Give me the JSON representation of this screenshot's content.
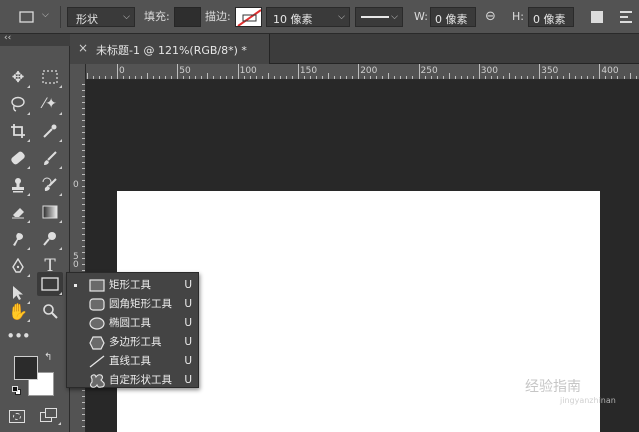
{
  "options_bar": {
    "mode_value": "形状",
    "fill_label": "填充:",
    "stroke_label": "描边:",
    "stroke_width_value": "10 像素",
    "w_label": "W:",
    "w_value": "0 像素",
    "h_label": "H:",
    "h_value": "0 像素"
  },
  "collapse_glyph": "‹‹",
  "document_tab": {
    "close_glyph": "×",
    "title": "未标题-1 @ 121%(RGB/8*) *"
  },
  "ruler_top": [
    "0",
    "50",
    "100",
    "150",
    "200",
    "250",
    "300",
    "350",
    "400"
  ],
  "ruler_left": [
    "0",
    "5",
    "0",
    "1"
  ],
  "flyout": {
    "items": [
      {
        "label": "矩形工具",
        "shortcut": "U",
        "icon": "rectangle-icon",
        "selected": true
      },
      {
        "label": "圆角矩形工具",
        "shortcut": "U",
        "icon": "rounded-rectangle-icon",
        "selected": false
      },
      {
        "label": "椭圆工具",
        "shortcut": "U",
        "icon": "ellipse-icon",
        "selected": false
      },
      {
        "label": "多边形工具",
        "shortcut": "U",
        "icon": "polygon-icon",
        "selected": false
      },
      {
        "label": "直线工具",
        "shortcut": "U",
        "icon": "line-icon",
        "selected": false
      },
      {
        "label": "自定形状工具",
        "shortcut": "U",
        "icon": "custom-shape-icon",
        "selected": false
      }
    ]
  },
  "colors": {
    "foreground": "#2b2b2b",
    "background": "#ffffff",
    "canvas": "#ffffff",
    "panel": "#535353"
  },
  "watermark": {
    "main": "经验指南",
    "sub": "jingyanzhinan"
  }
}
